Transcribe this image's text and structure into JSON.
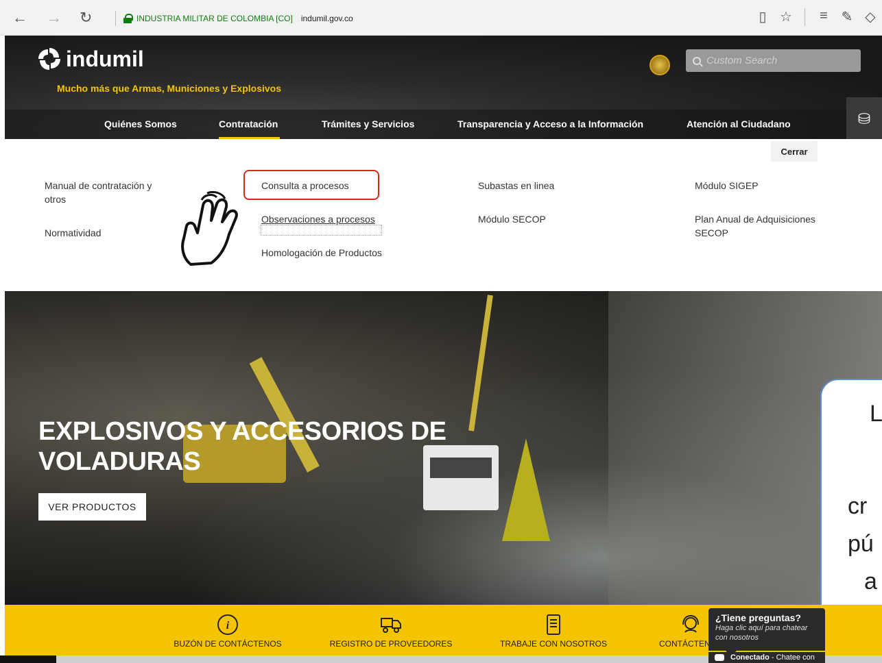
{
  "browser": {
    "back": "←",
    "forward": "→",
    "refresh": "↻",
    "cert_label": "INDUSTRIA MILITAR DE COLOMBIA [CO]",
    "url": "indumil.gov.co",
    "icons": [
      "reading-view-icon",
      "favorite-star-icon",
      "hub-icon",
      "web-note-icon",
      "share-icon"
    ],
    "icon_glyphs": [
      "▯",
      "☆",
      "≡",
      "✎",
      "◇"
    ]
  },
  "header": {
    "logo_text": "indumil",
    "tagline": "Mucho más que Armas, Municiones y Explosivos",
    "search_placeholder": "Custom Search",
    "nav": [
      "Quiénes Somos",
      "Contratación",
      "Trámites y Servicios",
      "Transparencia y Acceso a la Información",
      "Atención al Ciudadano"
    ],
    "active_nav": "Contratación",
    "paint_icon": "⛁"
  },
  "dropdown": {
    "close_label": "Cerrar",
    "col1": [
      "Manual de contratación y otros",
      "Normatividad"
    ],
    "col2": [
      "Consulta a procesos",
      "Observaciones a procesos",
      "Homologación de Productos"
    ],
    "col3": [
      "Subastas en linea",
      "Módulo SECOP"
    ],
    "col4": [
      "Módulo SIGEP",
      "Plan Anual de Adquisiciones SECOP"
    ],
    "accent_color": "#d9261c"
  },
  "hero": {
    "title": "EXPLOSIVOS Y ACCESORIOS DE VOLADURAS",
    "button_label": "VER PRODUCTOS"
  },
  "callout": {
    "lines": [
      "L",
      "cr",
      "pú",
      "a"
    ]
  },
  "bottom_bar": {
    "items": [
      "BUZÓN DE CONTÁCTENOS",
      "REGISTRO DE PROVEEDORES",
      "TRABAJE CON NOSOTROS",
      "CONTÁCTENOS"
    ],
    "color": "#f5c400"
  },
  "chat": {
    "question": "¿Tiene preguntas?",
    "subtitle": "Haga clic aquí para chatear con nosotros",
    "status_bold": "Conectado",
    "status_text": " - Chatee con"
  }
}
